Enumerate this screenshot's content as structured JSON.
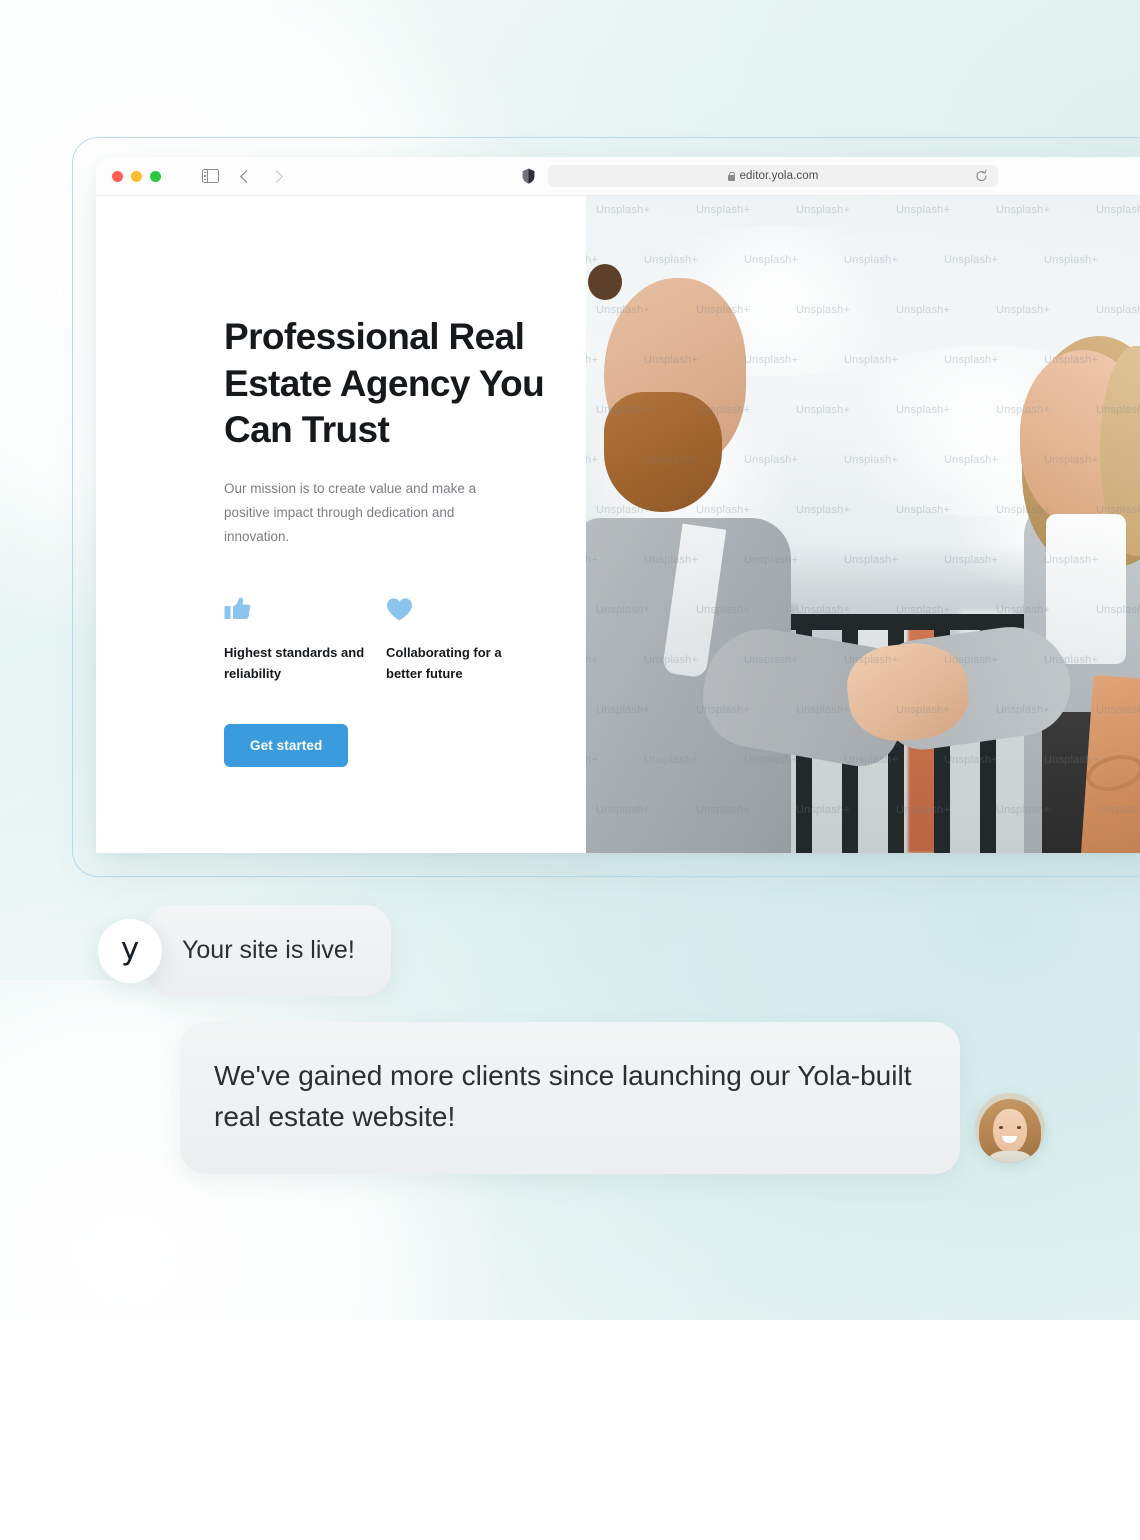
{
  "browser": {
    "traffic_lights": [
      "close",
      "minimize",
      "maximize"
    ],
    "url": "editor.yola.com",
    "icons": {
      "sidebar_toggle": "sidebar-toggle-icon",
      "back": "chevron-left-icon",
      "forward": "chevron-right-icon",
      "shield": "shield-icon",
      "lock": "lock-icon",
      "reload": "reload-icon"
    }
  },
  "site": {
    "title": "Professional Real Estate Agency You Can Trust",
    "subtitle": "Our mission is to create value and make a positive impact through dedication and innovation.",
    "features": [
      {
        "icon": "thumbs-up-icon",
        "label": "Highest standards and reliability"
      },
      {
        "icon": "heart-icon",
        "label": "Collaborating for a better future"
      }
    ],
    "cta_label": "Get started",
    "photo_alt": "Two business people shaking hands on a rooftop",
    "photo_watermark": "Unsplash+"
  },
  "chat": {
    "brand_initial": "y",
    "message_1": "Your site is live!",
    "message_2": "We've gained more clients since launching our Yola-built real estate website!"
  },
  "colors": {
    "accent_blue": "#3a9cdd",
    "feature_icon_blue": "#8bc4ec",
    "heading": "#16191c",
    "body_text": "#7b7f85",
    "bubble_bg": "#f0f1f3",
    "frame_border": "#b9dced"
  }
}
